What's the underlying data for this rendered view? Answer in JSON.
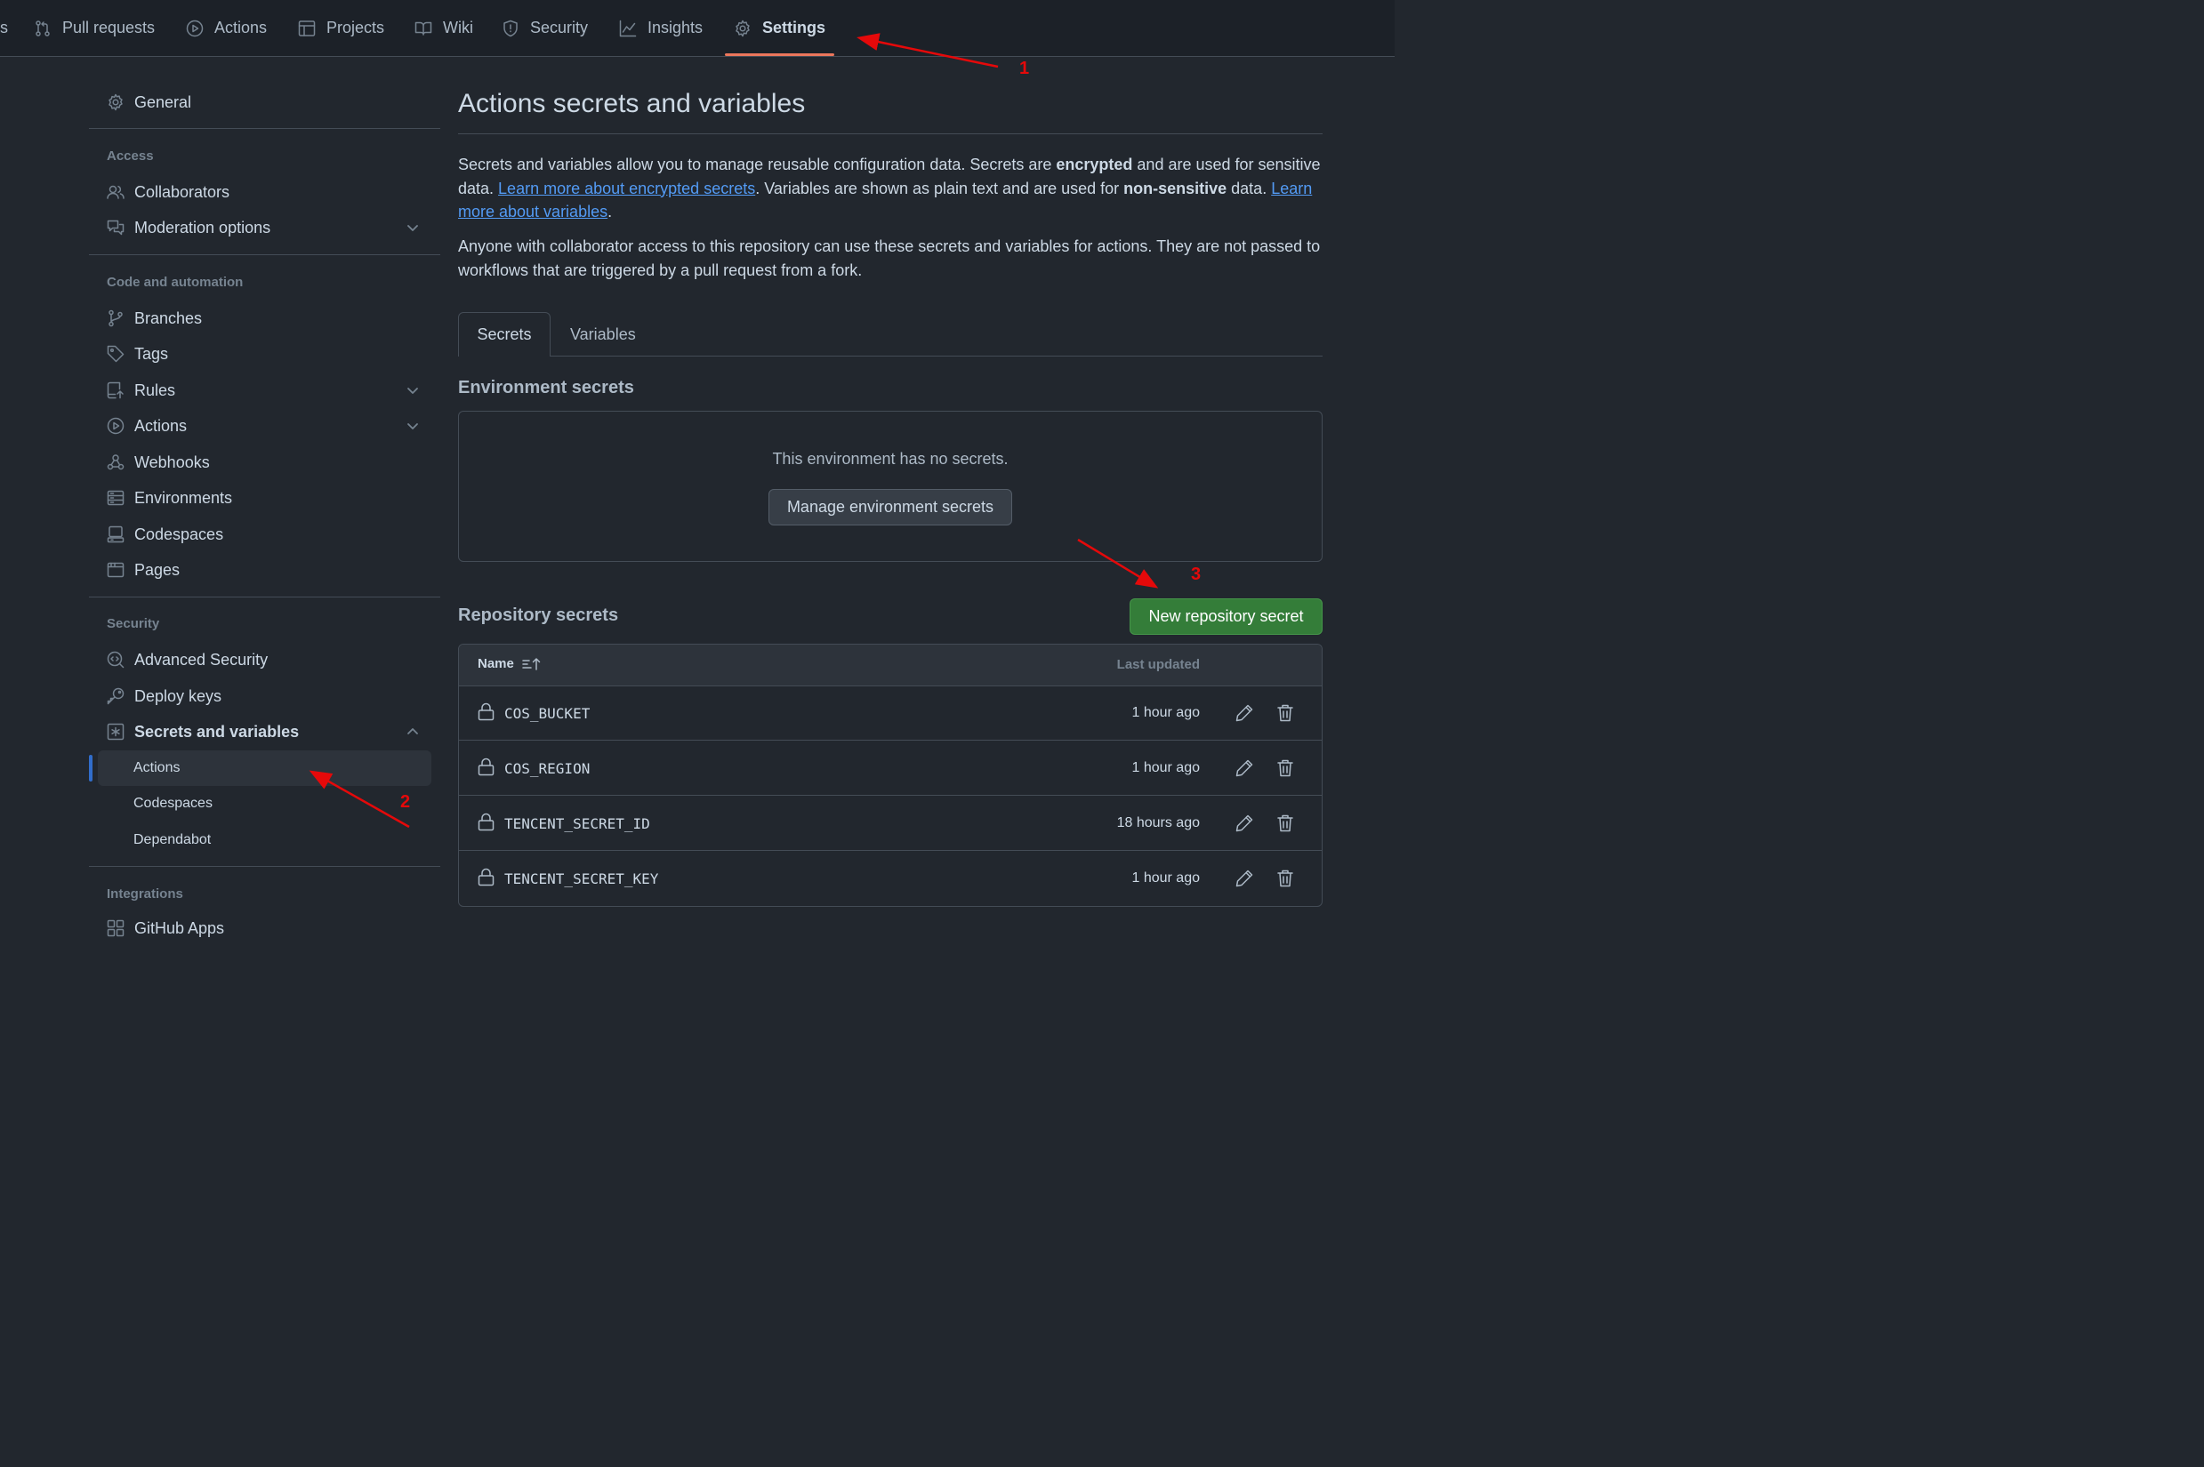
{
  "topnav": {
    "items": [
      {
        "label": "s",
        "icon": "overflow-fragment"
      },
      {
        "label": "Pull requests",
        "icon": "pull-request-icon"
      },
      {
        "label": "Actions",
        "icon": "play-icon"
      },
      {
        "label": "Projects",
        "icon": "table-icon"
      },
      {
        "label": "Wiki",
        "icon": "book-icon"
      },
      {
        "label": "Security",
        "icon": "shield-icon"
      },
      {
        "label": "Insights",
        "icon": "graph-icon"
      },
      {
        "label": "Settings",
        "icon": "gear-icon"
      }
    ],
    "active": "Settings"
  },
  "sidebar": {
    "general": "General",
    "access_heading": "Access",
    "collaborators": "Collaborators",
    "moderation": "Moderation options",
    "code_heading": "Code and automation",
    "branches": "Branches",
    "tags": "Tags",
    "rules": "Rules",
    "actions": "Actions",
    "webhooks": "Webhooks",
    "environments": "Environments",
    "codespaces": "Codespaces",
    "pages": "Pages",
    "security_heading": "Security",
    "advanced_security": "Advanced Security",
    "deploy_keys": "Deploy keys",
    "secrets_variables": "Secrets and variables",
    "sub_actions": "Actions",
    "sub_codespaces": "Codespaces",
    "sub_dependabot": "Dependabot",
    "integrations_heading": "Integrations",
    "github_apps": "GitHub Apps"
  },
  "main": {
    "title": "Actions secrets and variables",
    "p1_a": "Secrets and variables allow you to manage reusable configuration data. Secrets are ",
    "p1_b": "encrypted",
    "p1_c": " and are used for sensitive data. ",
    "p1_link1": "Learn more about encrypted secrets",
    "p1_d": ". Variables are shown as plain text and are used for ",
    "p1_e": "non-sensitive",
    "p1_f": " data. ",
    "p1_link2": "Learn more about variables",
    "p1_g": ".",
    "p2": "Anyone with collaborator access to this repository can use these secrets and variables for actions. They are not passed to workflows that are triggered by a pull request from a fork.",
    "tabs": {
      "secrets": "Secrets",
      "variables": "Variables"
    },
    "env_heading": "Environment secrets",
    "env_empty": "This environment has no secrets.",
    "env_button": "Manage environment secrets",
    "repo_heading": "Repository secrets",
    "new_button": "New repository secret",
    "table": {
      "col_name": "Name",
      "col_updated": "Last updated",
      "rows": [
        {
          "name": "COS_BUCKET",
          "updated": "1 hour ago"
        },
        {
          "name": "COS_REGION",
          "updated": "1 hour ago"
        },
        {
          "name": "TENCENT_SECRET_ID",
          "updated": "18 hours ago"
        },
        {
          "name": "TENCENT_SECRET_KEY",
          "updated": "1 hour ago"
        }
      ]
    }
  },
  "annotations": {
    "a1": "1",
    "a2": "2",
    "a3": "3",
    "color": "#e5090a"
  },
  "colors": {
    "accent_green": "#347d39",
    "link": "#539bf5",
    "tab_underline": "#ec775c",
    "selected_bar": "#316dca"
  }
}
